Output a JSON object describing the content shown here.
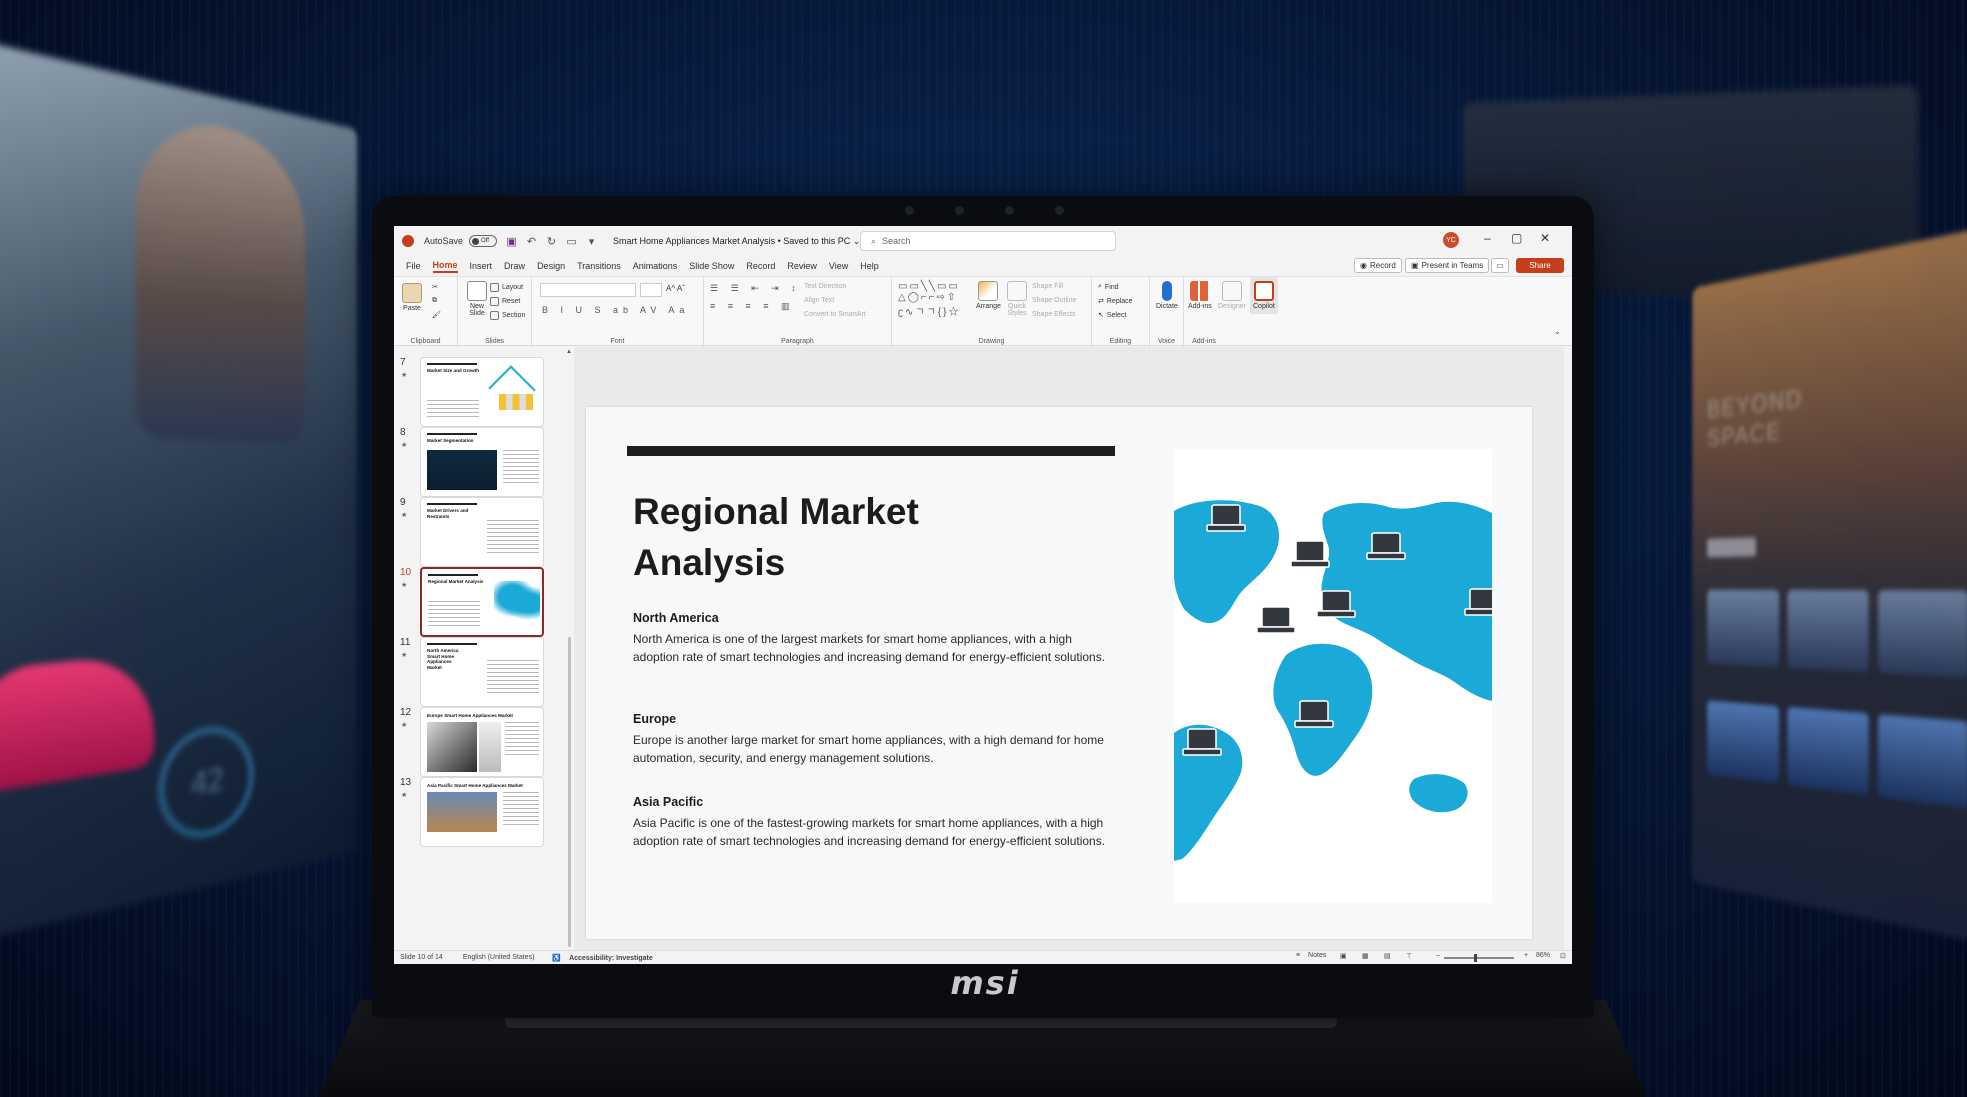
{
  "titlebar": {
    "autosave_label": "AutoSave",
    "autosave_state": "Off",
    "doc_title": "Smart Home Appliances Market Analysis • Saved to this PC ⌄",
    "search_placeholder": "Search",
    "avatar_initials": "YC"
  },
  "tabs": [
    "File",
    "Home",
    "Insert",
    "Draw",
    "Design",
    "Transitions",
    "Animations",
    "Slide Show",
    "Record",
    "Review",
    "View",
    "Help"
  ],
  "tab_buttons": {
    "record": "Record",
    "present_teams": "Present in Teams",
    "share": "Share"
  },
  "ribbon": {
    "clipboard": {
      "label": "Clipboard",
      "paste": "Paste"
    },
    "slides": {
      "label": "Slides",
      "new_slide": "New Slide",
      "layout": "Layout",
      "reset": "Reset",
      "section": "Section"
    },
    "font": {
      "label": "Font",
      "glyphs": "B I U S ab AV Aa"
    },
    "paragraph": {
      "label": "Paragraph",
      "text_direction": "Text Direction",
      "align_text": "Align Text",
      "convert_smartart": "Convert to SmartArt"
    },
    "drawing": {
      "label": "Drawing",
      "arrange": "Arrange",
      "quick_styles": "Quick Styles",
      "shape_fill": "Shape Fill",
      "shape_outline": "Shape Outline",
      "shape_effects": "Shape Effects"
    },
    "editing": {
      "label": "Editing",
      "find": "Find",
      "replace": "Replace",
      "select": "Select"
    },
    "voice": {
      "label": "Voice",
      "dictate": "Dictate"
    },
    "addins": {
      "label": "Add-ins",
      "addins": "Add-ins",
      "designer": "Designer",
      "copilot": "Copilot"
    }
  },
  "thumbnails": [
    {
      "num": "7",
      "title": "Market Size and Growth"
    },
    {
      "num": "8",
      "title": "Market Segmentation"
    },
    {
      "num": "9",
      "title": "Market Drivers and Restraints"
    },
    {
      "num": "10",
      "title": "Regional Market Analysis"
    },
    {
      "num": "11",
      "title": "North America Smart Home Appliances Market"
    },
    {
      "num": "12",
      "title": "Europe Smart Home Appliances Market"
    },
    {
      "num": "13",
      "title": "Asia Pacific Smart Home Appliances Market"
    }
  ],
  "slide": {
    "title": "Regional Market Analysis",
    "sections": [
      {
        "heading": "North America",
        "body": "North America is one of the largest markets for smart home appliances, with a high adoption rate of smart technologies and increasing demand for energy-efficient solutions."
      },
      {
        "heading": "Europe",
        "body": "Europe is another large market for smart home appliances, with a high demand for home automation, security, and energy management solutions."
      },
      {
        "heading": "Asia Pacific",
        "body": "Asia Pacific is one of the fastest-growing markets for smart home appliances, with a high adoption rate of smart technologies and increasing demand for energy-efficient solutions."
      }
    ],
    "map_color": "#1ba9d8"
  },
  "statusbar": {
    "slide_count": "Slide 10 of 14",
    "language": "English (United States)",
    "accessibility": "Accessibility: Investigate",
    "notes": "Notes",
    "zoom": "86%"
  },
  "laptop": {
    "brand": "msi"
  },
  "background": {
    "right_panel_title": "BEYOND SPACE",
    "gauge_value": "42"
  },
  "colors": {
    "accent": "#c43e1c",
    "map": "#1ba9d8"
  }
}
